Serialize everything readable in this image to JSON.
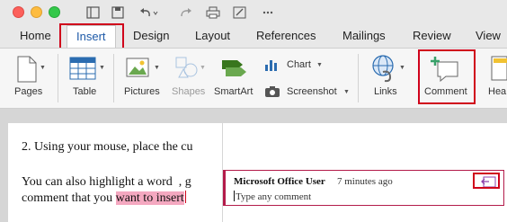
{
  "ribbon_tabs": [
    {
      "label": "Home"
    },
    {
      "label": "Insert",
      "active": true
    },
    {
      "label": "Design"
    },
    {
      "label": "Layout"
    },
    {
      "label": "References"
    },
    {
      "label": "Mailings"
    },
    {
      "label": "Review"
    },
    {
      "label": "View"
    }
  ],
  "ribbon": {
    "pages": "Pages",
    "table": "Table",
    "pictures": "Pictures",
    "shapes": "Shapes",
    "smartart": "SmartArt",
    "chart": "Chart",
    "screenshot": "Screenshot",
    "links": "Links",
    "comment": "Comment",
    "header_partial": "Hea"
  },
  "document": {
    "line1": "2. Using your mouse, place the cu",
    "line2": "You can also highlight a word  , g",
    "line3_before": "comment that you ",
    "line3_highlight": "want to insert"
  },
  "comment": {
    "author": "Microsoft Office User",
    "time": "7 minutes ago",
    "body": "Type any comment"
  },
  "colors": {
    "accent_tab": "#1e5aa8",
    "callout_red": "#d0021b",
    "comment_border": "#b31b4a",
    "highlight": "#f4a8c0"
  }
}
